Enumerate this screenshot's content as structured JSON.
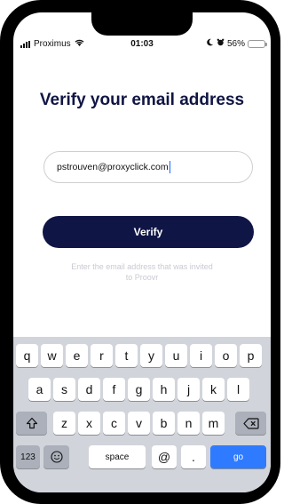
{
  "status_bar": {
    "carrier": "Proximus",
    "time": "01:03",
    "battery": "56%",
    "battery_level": 0.56
  },
  "page": {
    "title": "Verify your email address",
    "email_value": "pstrouven@proxyclick.com",
    "verify_label": "Verify",
    "hint_line1": "Enter the email address that was invited",
    "hint_line2": "to Proovr"
  },
  "keyboard": {
    "row1": [
      "q",
      "w",
      "e",
      "r",
      "t",
      "y",
      "u",
      "i",
      "o",
      "p"
    ],
    "row2": [
      "a",
      "s",
      "d",
      "f",
      "g",
      "h",
      "j",
      "k",
      "l"
    ],
    "row3": [
      "z",
      "x",
      "c",
      "v",
      "b",
      "n",
      "m"
    ],
    "numbers_label": "123",
    "space_label": "space",
    "at_label": "@",
    "dot_label": ".",
    "go_label": "go"
  }
}
